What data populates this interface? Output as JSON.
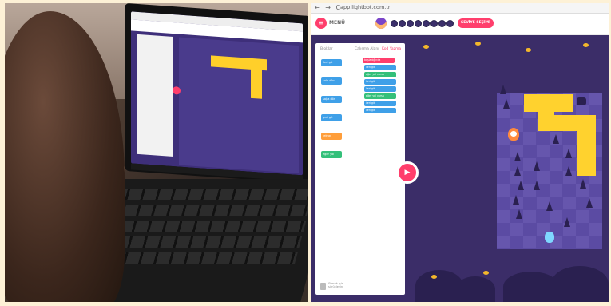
{
  "browser": {
    "url": "app.lightbot.com.tr",
    "nav_icons": "← → C"
  },
  "header": {
    "menu_label": "MENÜ",
    "level_badge": "SEVİYE SEÇİMİ",
    "step_count": 8
  },
  "palette": {
    "tabs": [
      {
        "label": "Bloklar",
        "active": false
      },
      {
        "label": "Çalışma Alanı",
        "active": false
      },
      {
        "label": "Kod Yazma",
        "active": true
      }
    ],
    "blocks": [
      {
        "label": "ileri git",
        "color": "#3fa0e8"
      },
      {
        "label": "sola dön",
        "color": "#3fa0e8"
      },
      {
        "label": "sağa dön",
        "color": "#3fa0e8"
      },
      {
        "label": "geri git",
        "color": "#3fa0e8"
      },
      {
        "label": "tekrar",
        "color": "#ff9e3a"
      },
      {
        "label": "eğer yol varsa",
        "color": "#34c07a"
      }
    ],
    "workspace_blocks": [
      {
        "label": "başladığında",
        "kind": "start"
      },
      {
        "label": "ileri git",
        "kind": "move"
      },
      {
        "label": "eğer yol varsa",
        "kind": "cond"
      },
      {
        "label": "ileri git",
        "kind": "move"
      },
      {
        "label": "ileri git",
        "kind": "move"
      },
      {
        "label": "eğer yol varsa",
        "kind": "cond"
      },
      {
        "label": "ileri git",
        "kind": "move"
      },
      {
        "label": "ileri git",
        "kind": "move"
      }
    ],
    "trash_label": "Silmek için sürükleyin"
  },
  "colors": {
    "accent": "#ff3e6c",
    "workspace_bg": "#3b2d68",
    "path_yellow": "#ffd22e",
    "block_blue": "#3fa0e8",
    "block_green": "#34c07a",
    "block_orange": "#ff9e3a"
  },
  "icons": {
    "menu": "menu-icon",
    "run": "play-icon",
    "trash": "trash-icon"
  }
}
